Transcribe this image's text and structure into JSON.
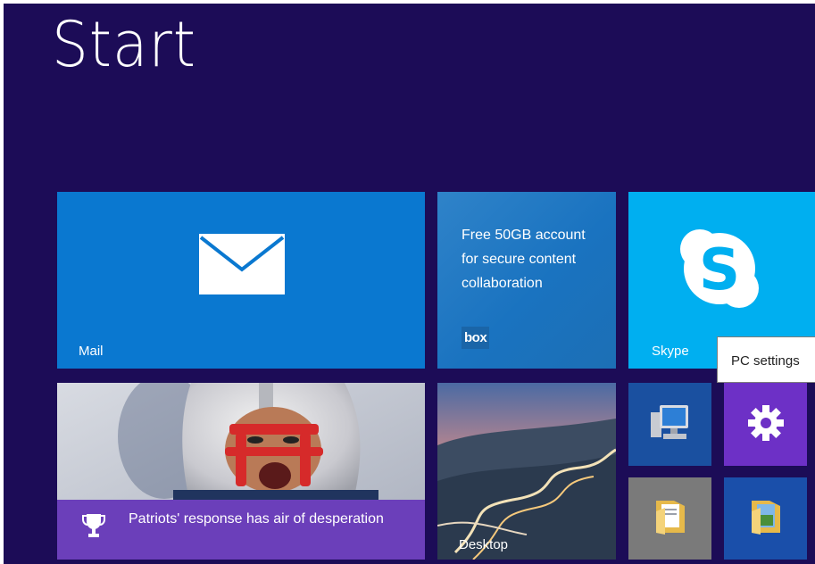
{
  "screen": {
    "title": "Start"
  },
  "tiles": {
    "mail": {
      "label": "Mail",
      "icon": "envelope-icon",
      "color": "#0a78d0"
    },
    "box": {
      "promo_text": "Free 50GB account for secure content collaboration",
      "logo_text": "box",
      "color": "#1a73c0"
    },
    "skype": {
      "label": "Skype",
      "icon": "skype-icon",
      "color": "#00aff0"
    },
    "news": {
      "headline": "Patriots' response has air of desperation",
      "icon": "trophy-icon",
      "bar_color": "#6b3fba"
    },
    "desktop": {
      "label": "Desktop"
    },
    "computer": {
      "icon": "computer-monitor-icon",
      "color": "#1a50a0"
    },
    "pc_settings": {
      "icon": "gear-icon",
      "color": "#6d30c6"
    },
    "folder1": {
      "icon": "folder-icon",
      "color": "#7a7a7a"
    },
    "folder2": {
      "icon": "folder-icon",
      "color": "#1a4faa"
    }
  },
  "tooltip": {
    "text": "PC settings"
  },
  "colors": {
    "background": "#1c0c57"
  }
}
